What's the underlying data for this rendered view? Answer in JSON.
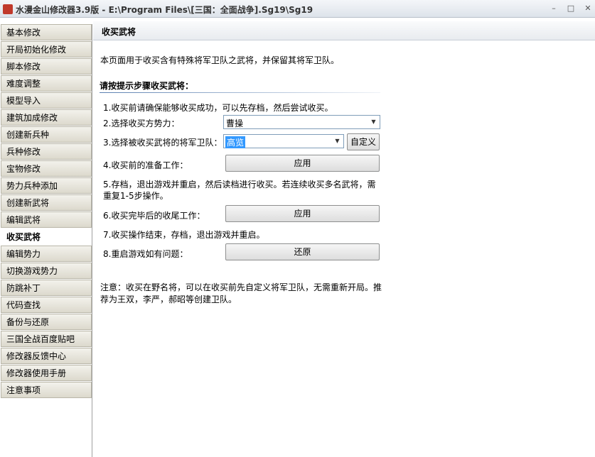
{
  "window": {
    "title": "水漫金山修改器3.9版 - E:\\Program Files\\[三国：全面战争].Sg19\\Sg19",
    "minimize": "–",
    "maximize": "□",
    "close": "✕"
  },
  "sidebar": {
    "items": [
      {
        "label": "基本修改"
      },
      {
        "label": "开局初始化修改"
      },
      {
        "label": "脚本修改"
      },
      {
        "label": "难度调整"
      },
      {
        "label": "模型导入"
      },
      {
        "label": "建筑加成修改"
      },
      {
        "label": "创建新兵种"
      },
      {
        "label": "兵种修改"
      },
      {
        "label": "宝物修改"
      },
      {
        "label": "势力兵种添加"
      },
      {
        "label": "创建新武将"
      },
      {
        "label": "编辑武将"
      },
      {
        "label": "收买武将"
      },
      {
        "label": "编辑势力"
      },
      {
        "label": "切换游戏势力"
      },
      {
        "label": "防跳补丁"
      },
      {
        "label": "代码查找"
      },
      {
        "label": "备份与还原"
      },
      {
        "label": "三国全战百度贴吧"
      },
      {
        "label": "修改器反馈中心"
      },
      {
        "label": "修改器使用手册"
      },
      {
        "label": "注意事项"
      }
    ],
    "active_index": 12
  },
  "main": {
    "header_title": "收买武将",
    "intro": "本页面用于收买含有特殊将军卫队之武将，并保留其将军卫队。",
    "section_title": "请按提示步骤收买武将：",
    "step1": "1.收买前请确保能够收买成功，可以先存档，然后尝试收买。",
    "step2_label": "2.选择收买方势力：",
    "step2_value": "曹操",
    "step3_label": "3.选择被收买武将的将军卫队：",
    "step3_value": "高览",
    "custom_button": "自定义",
    "step4_label": "4.收买前的准备工作：",
    "apply_button_1": "应用",
    "step5_line1": "5.存档，退出游戏并重启，然后读档进行收买。若连续收买多名武将，需",
    "step5_line2": "重复1-5步操作。",
    "step6_label": "6.收买完毕后的收尾工作：",
    "apply_button_2": "应用",
    "step7": "7.收买操作结束，存档，退出游戏并重启。",
    "step8_label": "8.重启游戏如有问题：",
    "restore_button": "还原",
    "note_line1": "注意：收买在野名将，可以在收买前先自定义将军卫队，无需重新开局。推",
    "note_line2": "荐为王双，李严，郝昭等创建卫队。"
  }
}
